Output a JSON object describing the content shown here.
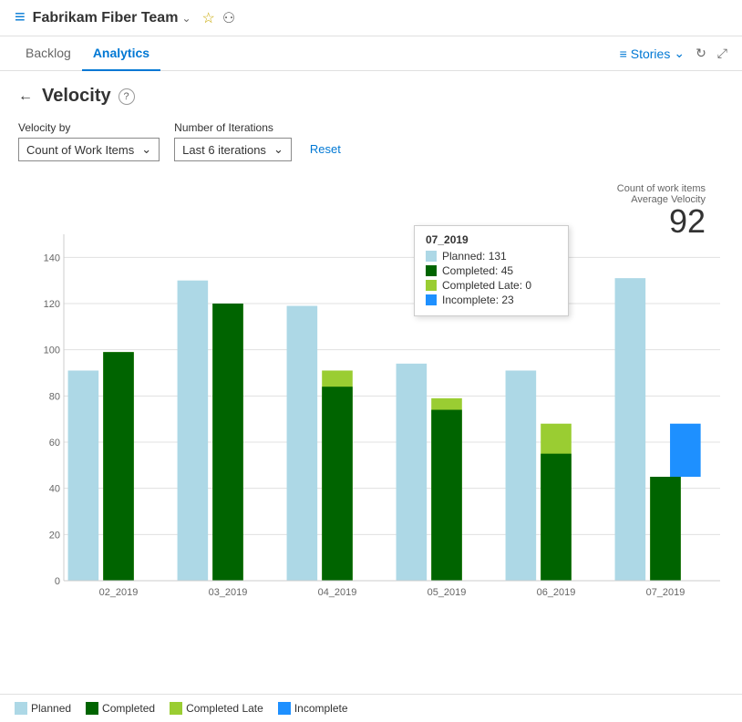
{
  "header": {
    "team_name": "Fabrikam Fiber Team",
    "icon": "≡"
  },
  "nav": {
    "tabs": [
      {
        "label": "Backlog",
        "active": false
      },
      {
        "label": "Analytics",
        "active": true
      }
    ],
    "stories_label": "Stories",
    "refresh_title": "Refresh",
    "expand_title": "Expand"
  },
  "page": {
    "title": "Velocity",
    "back_label": "←",
    "help_label": "?"
  },
  "controls": {
    "velocity_by_label": "Velocity by",
    "velocity_by_value": "Count of Work Items",
    "iterations_label": "Number of Iterations",
    "iterations_value": "Last 6 iterations",
    "reset_label": "Reset"
  },
  "chart": {
    "stats_label1": "Count of work items",
    "stats_label2": "Average Velocity",
    "stats_value": "92",
    "y_ticks": [
      "0",
      "20",
      "40",
      "60",
      "80",
      "100",
      "120",
      "140"
    ],
    "bars": [
      {
        "label": "02_2019",
        "planned": 91,
        "completed": 99,
        "completed_late": 0,
        "incomplete": 0
      },
      {
        "label": "03_2019",
        "planned": 130,
        "completed": 120,
        "completed_late": 0,
        "incomplete": 0
      },
      {
        "label": "04_2019",
        "planned": 119,
        "completed": 84,
        "completed_late": 7,
        "incomplete": 0
      },
      {
        "label": "05_2019",
        "planned": 94,
        "completed": 74,
        "completed_late": 5,
        "incomplete": 0
      },
      {
        "label": "06_2019",
        "planned": 91,
        "completed": 55,
        "completed_late": 13,
        "incomplete": 0
      },
      {
        "label": "07_2019",
        "planned": 131,
        "completed": 45,
        "completed_late": 0,
        "incomplete": 23
      }
    ],
    "tooltip": {
      "title": "07_2019",
      "rows": [
        {
          "label": "Planned: 131",
          "color": "#add8e6"
        },
        {
          "label": "Completed: 45",
          "color": "#006400"
        },
        {
          "label": "Completed Late: 0",
          "color": "#9acd32"
        },
        {
          "label": "Incomplete: 23",
          "color": "#1e90ff"
        }
      ]
    },
    "colors": {
      "planned": "#add8e6",
      "completed": "#006400",
      "completed_late": "#9acd32",
      "incomplete": "#1e90ff"
    }
  },
  "legend": [
    {
      "label": "Planned",
      "color": "#add8e6"
    },
    {
      "label": "Completed",
      "color": "#006400"
    },
    {
      "label": "Completed Late",
      "color": "#9acd32"
    },
    {
      "label": "Incomplete",
      "color": "#1e90ff"
    }
  ]
}
